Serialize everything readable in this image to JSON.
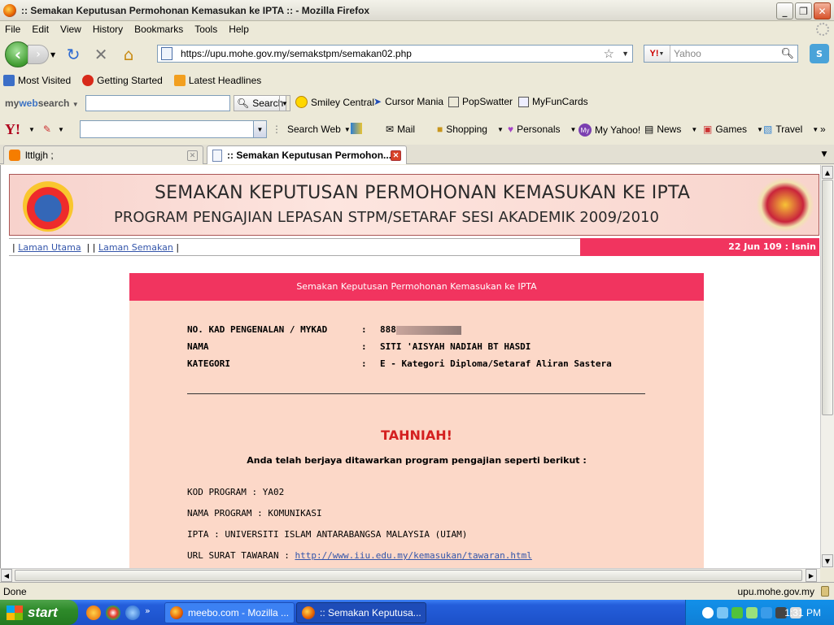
{
  "window": {
    "title": ":: Semakan Keputusan Permohonan Kemasukan ke IPTA :: - Mozilla Firefox"
  },
  "menu": [
    "File",
    "Edit",
    "View",
    "History",
    "Bookmarks",
    "Tools",
    "Help"
  ],
  "url": "https://upu.mohe.gov.my/semakstpm/semakan02.php",
  "search": {
    "engine": "Y!",
    "placeholder": "Yahoo"
  },
  "bookmarks": [
    "Most Visited",
    "Getting Started",
    "Latest Headlines"
  ],
  "mywebsearch": {
    "logo_a": "my",
    "logo_b": "web",
    "logo_c": "search",
    "search_btn": "Search",
    "items": [
      "Smiley Central",
      "Cursor Mania",
      "PopSwatter",
      "MyFunCards"
    ]
  },
  "yahoo_bar": {
    "logo": "Y!",
    "search_web": "Search Web",
    "items": [
      "Mail",
      "Shopping",
      "Personals",
      "My Yahoo!",
      "News",
      "Games",
      "Travel"
    ]
  },
  "tabs": [
    {
      "label": "lttlgjh ;"
    },
    {
      "label": ":: Semakan Keputusan Permohon..."
    }
  ],
  "page": {
    "banner_line1": "SEMAKAN KEPUTUSAN PERMOHONAN KEMASUKAN KE IPTA",
    "banner_line2": "PROGRAM PENGAJIAN LEPASAN STPM/SETARAF SESI AKADEMIK 2009/2010",
    "nav": {
      "home": "Laman Utama",
      "check": "Laman Semakan"
    },
    "date": "22 Jun 109 : Isnin",
    "box_title": "Semakan Keputusan Permohonan Kemasukan ke IPTA",
    "fields": [
      {
        "label": "NO. KAD PENGENALAN / MYKAD",
        "sep": ":",
        "value": "888"
      },
      {
        "label": "NAMA",
        "sep": ":",
        "value": "SITI 'AISYAH NADIAH BT HASDI"
      },
      {
        "label": "KATEGORI",
        "sep": ":",
        "value": "E - Kategori Diploma/Setaraf Aliran Sastera"
      }
    ],
    "tahniah": "TAHNIAH!",
    "offer_text": "Anda telah berjaya ditawarkan program pengajian seperti berikut :",
    "program": {
      "kod_label": "KOD PROGRAM : YA02",
      "nama_label": "NAMA PROGRAM : KOMUNIKASI",
      "ipta_label": "IPTA : UNIVERSITI ISLAM ANTARABANGSA MALAYSIA (UIAM)",
      "url_label": "URL SURAT TAWARAN : ",
      "url": "http://www.iiu.edu.my/kemasukan/tawaran.html"
    }
  },
  "status": {
    "text": "Done",
    "domain": "upu.mohe.gov.my"
  },
  "taskbar": {
    "start": "start",
    "tasks": [
      "meebo.com - Mozilla ...",
      ":: Semakan Keputusa..."
    ],
    "clock": "1:31 PM"
  }
}
